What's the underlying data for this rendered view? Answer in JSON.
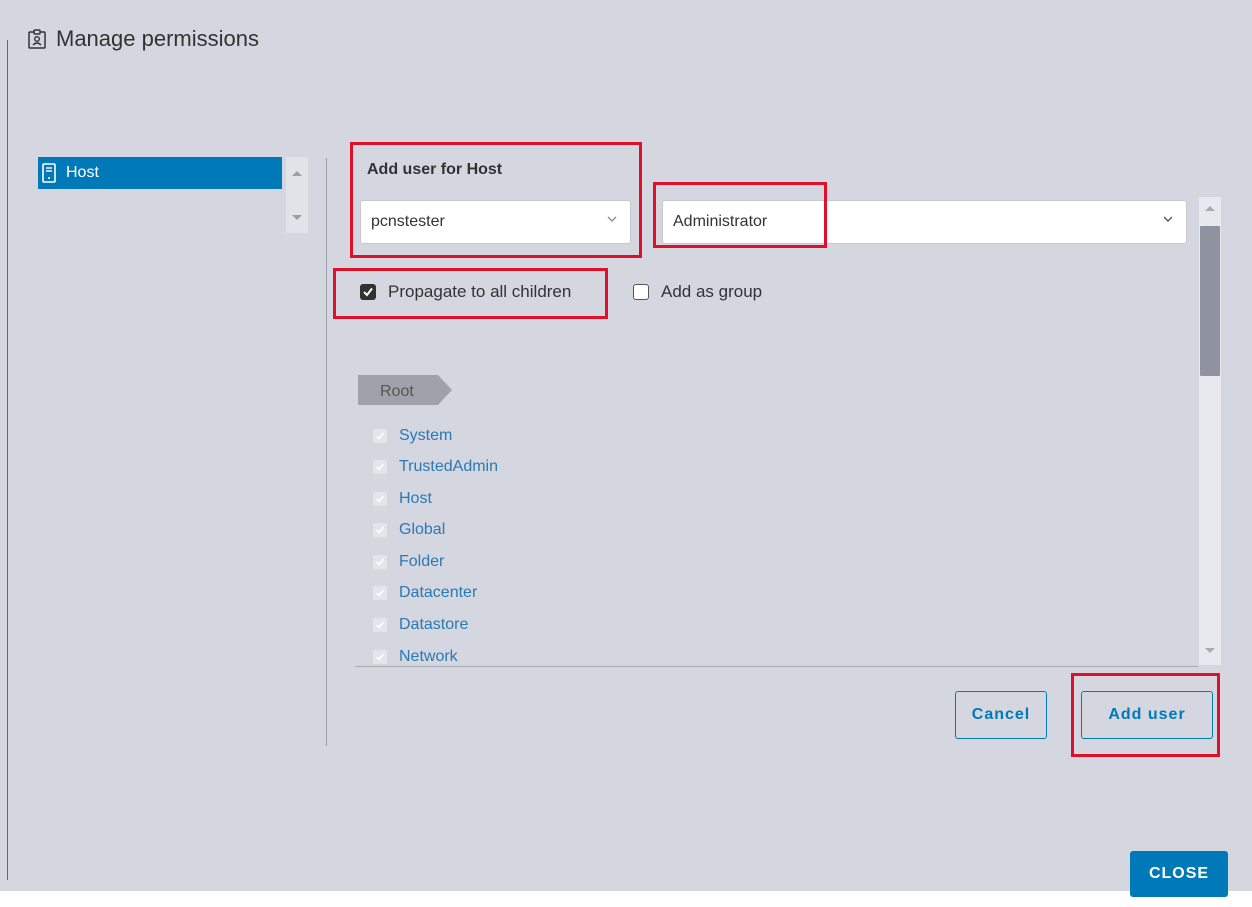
{
  "dialog": {
    "title": "Manage permissions",
    "title_icon": "permissions-icon"
  },
  "tree": {
    "selected_item": {
      "label": "Host",
      "icon": "host-server-icon"
    }
  },
  "form": {
    "section_label": "Add user for Host",
    "user_select": {
      "value": "pcnstester"
    },
    "role_select": {
      "value": "Administrator"
    },
    "propagate": {
      "label": "Propagate to all children",
      "checked": true
    },
    "add_as_group": {
      "label": "Add as group",
      "checked": false
    }
  },
  "privileges": {
    "root_label": "Root",
    "items": [
      {
        "label": "System",
        "checked": true
      },
      {
        "label": "TrustedAdmin",
        "checked": true
      },
      {
        "label": "Host",
        "checked": true
      },
      {
        "label": "Global",
        "checked": true
      },
      {
        "label": "Folder",
        "checked": true
      },
      {
        "label": "Datacenter",
        "checked": true
      },
      {
        "label": "Datastore",
        "checked": true
      },
      {
        "label": "Network",
        "checked": true
      }
    ]
  },
  "buttons": {
    "cancel": "Cancel",
    "add_user": "Add user",
    "close": "CLOSE"
  },
  "colors": {
    "accent": "#0079b8",
    "highlight": "#e0102a",
    "link": "#2b79b5",
    "background": "#d4d6e0"
  }
}
